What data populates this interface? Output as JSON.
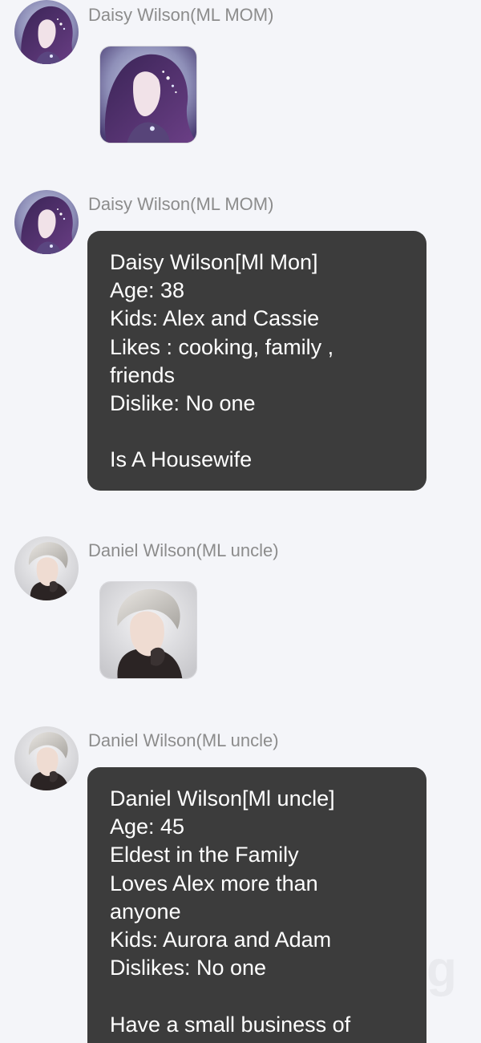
{
  "messages": [
    {
      "sender": "Daisy Wilson(ML MOM)",
      "type": "sticker",
      "avatar": "daisy-avatar"
    },
    {
      "sender": "Daisy Wilson(ML MOM)",
      "type": "text",
      "avatar": "daisy-avatar",
      "lines": [
        "Daisy Wilson[Ml Mon]",
        "Age: 38",
        "Kids: Alex and Cassie",
        "Likes : cooking, family ,",
        "friends",
        "Dislike: No one",
        "",
        "Is A Housewife"
      ]
    },
    {
      "sender": "Daniel Wilson(ML uncle)",
      "type": "sticker",
      "avatar": "daniel-avatar"
    },
    {
      "sender": "Daniel Wilson(ML uncle)",
      "type": "text",
      "avatar": "daniel-avatar",
      "lines": [
        "Daniel Wilson[Ml uncle]",
        "Age: 45",
        "Eldest in the Family",
        "Loves Alex more than",
        "anyone",
        "Kids: Aurora and Adam",
        "Dislikes: No one",
        "",
        "Have a small business of"
      ]
    }
  ],
  "watermark": "g",
  "colors": {
    "background": "#f4f5f9",
    "bubble": "#3c3c3c",
    "bubble_text": "#ffffff",
    "sender_text": "#8c8c8c"
  }
}
